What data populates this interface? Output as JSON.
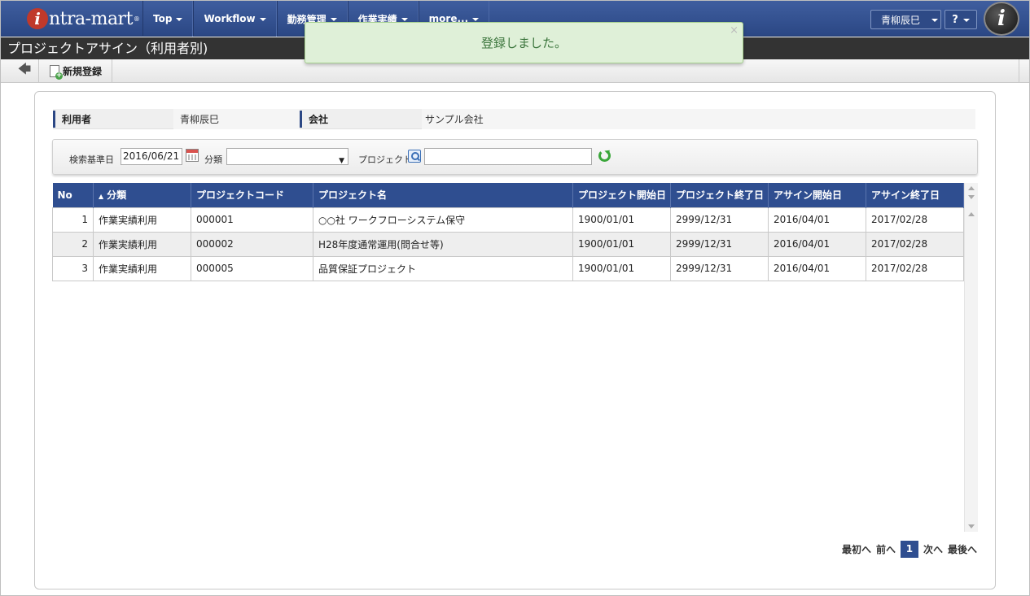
{
  "header": {
    "logo_text": "ntra-mart",
    "logo_reg": "®",
    "menu": [
      {
        "label": "Top"
      },
      {
        "label": "Workflow"
      },
      {
        "label": "勤務管理"
      },
      {
        "label": "作業実績"
      },
      {
        "label": "more..."
      }
    ],
    "user_name": "青柳辰巳",
    "help_label": "?"
  },
  "page_title": "プロジェクトアサイン（利用者別)",
  "toolbar": {
    "back_icon": "arrow-left-icon",
    "new_label": "新規登録"
  },
  "toast": {
    "message": "登録しました。",
    "close_label": "×"
  },
  "info": {
    "user_label": "利用者",
    "user_value": "青柳辰巳",
    "company_label": "会社",
    "company_value": "サンプル会社"
  },
  "search": {
    "date_label": "検索基準日",
    "date_value": "2016/06/21",
    "category_label": "分類",
    "category_value": "",
    "category_caret": "▼",
    "project_label": "プロジェクト",
    "project_value": ""
  },
  "grid": {
    "headers": [
      "No",
      "分類",
      "プロジェクトコード",
      "プロジェクト名",
      "プロジェクト開始日",
      "プロジェクト終了日",
      "アサイン開始日",
      "アサイン終了日"
    ],
    "sort_indicator": "▲",
    "rows": [
      {
        "no": "1",
        "category": "作業実績利用",
        "code": "000001",
        "name": "○○社 ワークフローシステム保守",
        "start": "1900/01/01",
        "end": "2999/12/31",
        "assign_start": "2016/04/01",
        "assign_end": "2017/02/28"
      },
      {
        "no": "2",
        "category": "作業実績利用",
        "code": "000002",
        "name": "H28年度通常運用(問合せ等)",
        "start": "1900/01/01",
        "end": "2999/12/31",
        "assign_start": "2016/04/01",
        "assign_end": "2017/02/28"
      },
      {
        "no": "3",
        "category": "作業実績利用",
        "code": "000005",
        "name": "品質保証プロジェクト",
        "start": "1900/01/01",
        "end": "2999/12/31",
        "assign_start": "2016/04/01",
        "assign_end": "2017/02/28"
      }
    ]
  },
  "pager": {
    "first": "最初へ",
    "prev": "前へ",
    "current": "1",
    "next": "次へ",
    "last": "最後へ"
  }
}
